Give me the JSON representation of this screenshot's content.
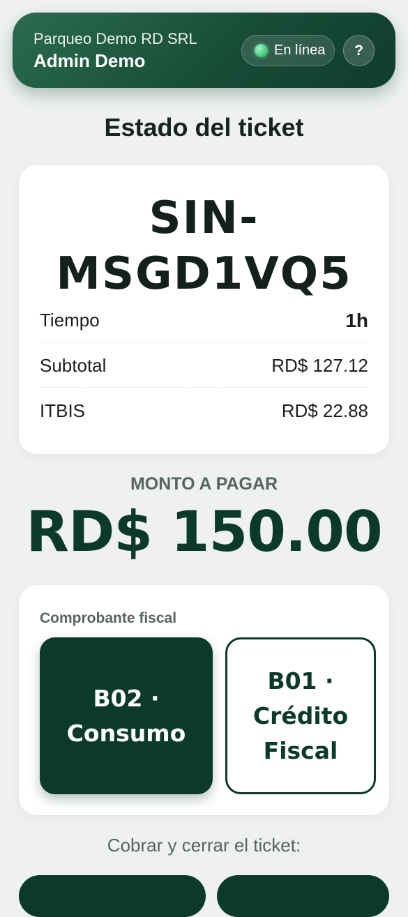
{
  "header": {
    "company": "Parqueo Demo RD SRL",
    "user": "Admin Demo",
    "status_label": "En línea",
    "status_icon": "online-dot-icon",
    "help_label": "?",
    "help_icon": "help-icon"
  },
  "page": {
    "title": "Estado del ticket"
  },
  "ticket": {
    "code_line1": "SIN-",
    "code_line2": "MSGD1VQ5",
    "rows": [
      {
        "label": "Tiempo",
        "value": "1h"
      },
      {
        "label": "Subtotal",
        "value": "RD$ 127.12"
      },
      {
        "label": "ITBIS",
        "value": "RD$ 22.88"
      }
    ]
  },
  "amount": {
    "label": "MONTO A PAGAR",
    "value": "RD$ 150.00"
  },
  "fiscal": {
    "label": "Comprobante fiscal",
    "options": [
      {
        "line1": "B02 ·",
        "line2": "Consumo",
        "line3": "",
        "selected": true
      },
      {
        "line1": "B01 ·",
        "line2": "Crédito",
        "line3": "Fiscal",
        "selected": false
      }
    ]
  },
  "collect": {
    "label": "Cobrar y cerrar el ticket:"
  },
  "colors": {
    "primary": "#0b3a2a",
    "header_gradient_start": "#2b6b50",
    "header_gradient_end": "#103c2c",
    "online": "#4ccf86",
    "background": "#eef1f0"
  }
}
